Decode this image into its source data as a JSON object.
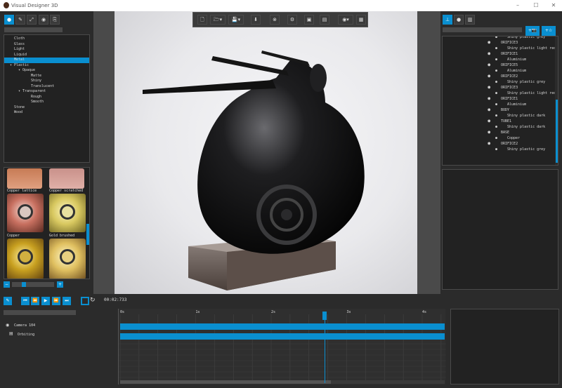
{
  "window": {
    "title": "Visual Designer 3D",
    "controls": [
      "–",
      "☐",
      "✕"
    ]
  },
  "left_toolbar": {
    "buttons": [
      "material-icon",
      "pencil-icon",
      "transform-icon",
      "sphere-icon",
      "export-icon"
    ]
  },
  "material_tree": {
    "items": [
      {
        "label": "Cloth",
        "indent": 0,
        "expander": ""
      },
      {
        "label": "Glass",
        "indent": 0,
        "expander": ""
      },
      {
        "label": "Light",
        "indent": 0,
        "expander": ""
      },
      {
        "label": "Liquid",
        "indent": 0,
        "expander": ""
      },
      {
        "label": "Metal",
        "indent": 0,
        "expander": "",
        "selected": true
      },
      {
        "label": "Plastic",
        "indent": 0,
        "expander": "▾"
      },
      {
        "label": "Opaque",
        "indent": 1,
        "expander": "▾"
      },
      {
        "label": "Matte",
        "indent": 2,
        "expander": ""
      },
      {
        "label": "Shiny",
        "indent": 2,
        "expander": ""
      },
      {
        "label": "Translucent",
        "indent": 2,
        "expander": ""
      },
      {
        "label": "Transparent",
        "indent": 1,
        "expander": "▾"
      },
      {
        "label": "Rough",
        "indent": 2,
        "expander": ""
      },
      {
        "label": "Smooth",
        "indent": 2,
        "expander": ""
      },
      {
        "label": "Stone",
        "indent": 0,
        "expander": ""
      },
      {
        "label": "Wood",
        "indent": 0,
        "expander": ""
      }
    ]
  },
  "material_library": {
    "labels": [
      "Copper lattice",
      "Copper scratched",
      "Copper",
      "Gold brushed"
    ]
  },
  "viewport_toolbar": {
    "buttons": [
      "new-file-icon",
      "open-icon",
      "save-icon",
      "import-icon",
      "render-icon",
      "settings-icon",
      "image-icon",
      "film-icon",
      "eye-icon",
      "grid-icon"
    ]
  },
  "right_toolbar": {
    "buttons": [
      "hierarchy-icon",
      "material-icon",
      "library-icon"
    ],
    "add_camera": "+📷",
    "add_light": "+☆"
  },
  "scene_tree": {
    "rows": [
      {
        "label": "Shiny plastic grey",
        "indent": 1,
        "icon": "●"
      },
      {
        "label": "ORIFICE3",
        "indent": 0,
        "icon": "⬢"
      },
      {
        "label": "Shiny plastic light red",
        "indent": 1,
        "icon": "●"
      },
      {
        "label": "ORIFICE1",
        "indent": 0,
        "icon": "⬢"
      },
      {
        "label": "Aluminium",
        "indent": 1,
        "icon": "●"
      },
      {
        "label": "ORIFICE5",
        "indent": 0,
        "icon": "⬢"
      },
      {
        "label": "Aluminium",
        "indent": 1,
        "icon": "●"
      },
      {
        "label": "ORIFICE2",
        "indent": 0,
        "icon": "⬢"
      },
      {
        "label": "Shiny plastic grey",
        "indent": 1,
        "icon": "●"
      },
      {
        "label": "ORIFICE3",
        "indent": 0,
        "icon": "⬢"
      },
      {
        "label": "Shiny plastic light red",
        "indent": 1,
        "icon": "●"
      },
      {
        "label": "ORIFICE1",
        "indent": 0,
        "icon": "⬢"
      },
      {
        "label": "Aluminium",
        "indent": 1,
        "icon": "●"
      },
      {
        "label": "BODY",
        "indent": 0,
        "icon": "⬢"
      },
      {
        "label": "Shiny plastic dark",
        "indent": 1,
        "icon": "●"
      },
      {
        "label": "TUBE1",
        "indent": 0,
        "icon": "⬢"
      },
      {
        "label": "Shiny plastic dark",
        "indent": 1,
        "icon": "●"
      },
      {
        "label": "BASE",
        "indent": 0,
        "icon": "⬢"
      },
      {
        "label": "Copper",
        "indent": 1,
        "icon": "●"
      },
      {
        "label": "ORIFICE2",
        "indent": 0,
        "icon": "⬢"
      },
      {
        "label": "Shiny plastic grey",
        "indent": 1,
        "icon": "●"
      }
    ]
  },
  "transport": {
    "time": "00:02:733"
  },
  "timeline": {
    "ticks": [
      "0s",
      "1s",
      "2s",
      "3s",
      "4s"
    ],
    "tracks": [
      "Camera 104",
      "Orbiting"
    ],
    "playhead": 0.63
  },
  "colors": {
    "accent": "#0a8fd0"
  }
}
